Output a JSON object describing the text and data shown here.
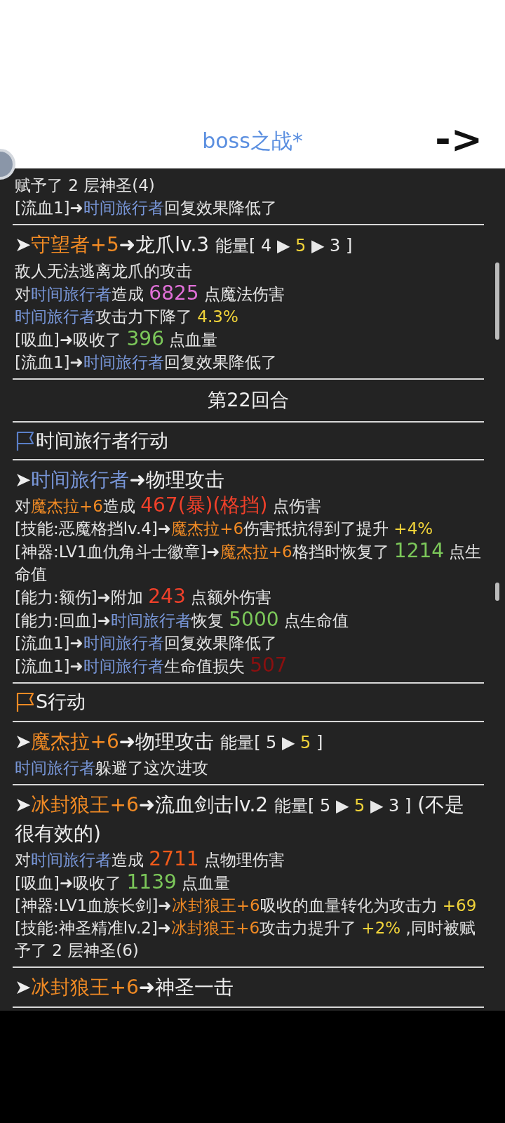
{
  "header": {
    "title": "boss之战*",
    "next_button": "->"
  },
  "log": [
    {
      "kind": "action",
      "lines": [
        [
          {
            "kind": "text",
            "text": "赋予了 2 层神圣(4)"
          }
        ],
        [
          {
            "kind": "text",
            "text": "[流血1]➜"
          },
          {
            "kind": "foe",
            "text": "时间旅行者"
          },
          {
            "kind": "text",
            "text": "回复效果降低了"
          }
        ]
      ]
    },
    {
      "kind": "action",
      "headline": [
        {
          "kind": "text",
          "text": "➤"
        },
        {
          "kind": "ally",
          "text": "守望者+5"
        },
        {
          "kind": "text",
          "text": "➜龙爪lv.3 "
        },
        {
          "kind": "energy",
          "text": "能量[ 4 ▶ "
        },
        {
          "kind": "gold_energy",
          "text": "5"
        },
        {
          "kind": "energy",
          "text": " ▶ 3 ]"
        }
      ],
      "lines": [
        [
          {
            "kind": "text",
            "text": "敌人无法逃离龙爪的攻击"
          }
        ],
        [
          {
            "kind": "text",
            "text": "对"
          },
          {
            "kind": "foe",
            "text": "时间旅行者"
          },
          {
            "kind": "text",
            "text": "造成 "
          },
          {
            "kind": "magic",
            "text": "6825"
          },
          {
            "kind": "text",
            "text": " 点魔法伤害"
          }
        ],
        [
          {
            "kind": "foe",
            "text": "时间旅行者"
          },
          {
            "kind": "text",
            "text": "攻击力下降了 "
          },
          {
            "kind": "gold",
            "text": "4.3%"
          }
        ],
        [
          {
            "kind": "text",
            "text": "[吸血]➜吸收了 "
          },
          {
            "kind": "heal",
            "text": "396"
          },
          {
            "kind": "text",
            "text": " 点血量"
          }
        ],
        [
          {
            "kind": "text",
            "text": "[流血1]➜"
          },
          {
            "kind": "foe",
            "text": "时间旅行者"
          },
          {
            "kind": "text",
            "text": "回复效果降低了"
          }
        ]
      ]
    },
    {
      "kind": "round",
      "text": "第22回合"
    },
    {
      "kind": "turn",
      "color": "#5a7fc8",
      "text": "时间旅行者行动"
    },
    {
      "kind": "action",
      "headline": [
        {
          "kind": "text",
          "text": "➤"
        },
        {
          "kind": "foe",
          "text": "时间旅行者"
        },
        {
          "kind": "text",
          "text": "➜物理攻击"
        }
      ],
      "lines": [
        [
          {
            "kind": "text",
            "text": "对"
          },
          {
            "kind": "ally",
            "text": "魔杰拉+6"
          },
          {
            "kind": "text",
            "text": "造成 "
          },
          {
            "kind": "damage",
            "text": "467(暴)(格挡)"
          },
          {
            "kind": "text",
            "text": " 点伤害"
          }
        ],
        [
          {
            "kind": "text",
            "text": "[技能:恶魔格挡lv.4]➜"
          },
          {
            "kind": "ally",
            "text": "魔杰拉+6"
          },
          {
            "kind": "text",
            "text": "伤害抵抗得到了提升 "
          },
          {
            "kind": "gold",
            "text": "+4%"
          }
        ],
        [
          {
            "kind": "text",
            "text": "[神器:LV1血仇角斗士徽章]➜"
          },
          {
            "kind": "ally",
            "text": "魔杰拉+6"
          },
          {
            "kind": "text",
            "text": "格挡时恢复了  "
          },
          {
            "kind": "heal",
            "text": "1214"
          },
          {
            "kind": "text",
            "text": "  点生命值"
          }
        ],
        [
          {
            "kind": "text",
            "text": "[能力:额伤]➜附加  "
          },
          {
            "kind": "damage",
            "text": "243"
          },
          {
            "kind": "text",
            "text": "  点额外伤害"
          }
        ],
        [
          {
            "kind": "text",
            "text": "[能力:回血]➜"
          },
          {
            "kind": "foe",
            "text": "时间旅行者"
          },
          {
            "kind": "text",
            "text": "恢复  "
          },
          {
            "kind": "heal",
            "text": "5000"
          },
          {
            "kind": "text",
            "text": "  点生命值"
          }
        ],
        [
          {
            "kind": "text",
            "text": "[流血1]➜"
          },
          {
            "kind": "foe",
            "text": "时间旅行者"
          },
          {
            "kind": "text",
            "text": "回复效果降低了"
          }
        ],
        [
          {
            "kind": "text",
            "text": "[流血1]➜"
          },
          {
            "kind": "foe",
            "text": "时间旅行者"
          },
          {
            "kind": "text",
            "text": "生命值损失 "
          },
          {
            "kind": "bleed",
            "text": "507"
          }
        ]
      ]
    },
    {
      "kind": "turn",
      "color": "#f08a24",
      "text": "S行动"
    },
    {
      "kind": "action",
      "headline": [
        {
          "kind": "text",
          "text": "➤"
        },
        {
          "kind": "ally",
          "text": "魔杰拉+6"
        },
        {
          "kind": "text",
          "text": "➜物理攻击 "
        },
        {
          "kind": "energy",
          "text": "能量[ 5 ▶ "
        },
        {
          "kind": "gold_energy",
          "text": "5"
        },
        {
          "kind": "energy",
          "text": " ]"
        }
      ],
      "lines": [
        [
          {
            "kind": "foe",
            "text": "时间旅行者"
          },
          {
            "kind": "text",
            "text": "躲避了这次进攻"
          }
        ]
      ]
    },
    {
      "kind": "action",
      "headline": [
        {
          "kind": "text",
          "text": "➤"
        },
        {
          "kind": "ally",
          "text": "冰封狼王+6"
        },
        {
          "kind": "text",
          "text": "➜流血剑击lv.2 "
        },
        {
          "kind": "energy",
          "text": "能量[ 5 ▶ "
        },
        {
          "kind": "gold_energy",
          "text": "5"
        },
        {
          "kind": "energy",
          "text": " ▶ 3 ]"
        },
        {
          "kind": "text",
          "text": " (不是很有效的)"
        }
      ],
      "lines": [
        [
          {
            "kind": "text",
            "text": "对"
          },
          {
            "kind": "foe",
            "text": "时间旅行者"
          },
          {
            "kind": "text",
            "text": "造成 "
          },
          {
            "kind": "hit",
            "text": "2711"
          },
          {
            "kind": "text",
            "text": " 点物理伤害"
          }
        ],
        [
          {
            "kind": "text",
            "text": "[吸血]➜吸收了 "
          },
          {
            "kind": "heal",
            "text": "1139"
          },
          {
            "kind": "text",
            "text": " 点血量"
          }
        ],
        [
          {
            "kind": "text",
            "text": "[神器:LV1血族长剑]➜"
          },
          {
            "kind": "ally",
            "text": "冰封狼王+6"
          },
          {
            "kind": "text",
            "text": "吸收的血量转化为攻击力 "
          },
          {
            "kind": "gold",
            "text": "+69"
          }
        ],
        [
          {
            "kind": "text",
            "text": "[技能:神圣精准lv.2]➜"
          },
          {
            "kind": "ally",
            "text": "冰封狼王+6"
          },
          {
            "kind": "text",
            "text": "攻击力提升了 "
          },
          {
            "kind": "gold",
            "text": "+2%"
          },
          {
            "kind": "text",
            "text": " ,同时被赋予了 2 层神圣(6)"
          }
        ]
      ]
    },
    {
      "kind": "action",
      "headline": [
        {
          "kind": "text",
          "text": "➤"
        },
        {
          "kind": "ally",
          "text": "冰封狼王+6"
        },
        {
          "kind": "text",
          "text": "➜神圣一击"
        }
      ]
    }
  ]
}
